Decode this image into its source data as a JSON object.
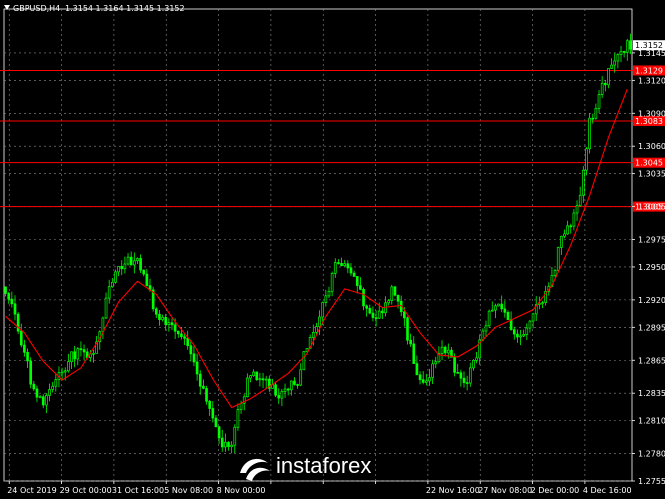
{
  "header": {
    "symbol": "GBPUSD,H4",
    "ohlc": "1.3154 1.3164 1.3145 1.3152"
  },
  "watermark": {
    "text": "instaforex"
  },
  "colors": {
    "background": "#000000",
    "grid": "#8c8c8c",
    "candle": "#00ff00",
    "level": "#ff0000",
    "moving_average": "#ff0000",
    "axis": "#ffffff"
  },
  "chart_data": {
    "type": "candlestick",
    "symbol": "GBPUSD",
    "timeframe": "H4",
    "ylim": [
      1.2755,
      1.3185
    ],
    "y_ticks": [
      1.3145,
      1.312,
      1.309,
      1.306,
      1.3035,
      1.3005,
      1.2975,
      1.295,
      1.292,
      1.2895,
      1.2865,
      1.2835,
      1.281,
      1.278,
      1.2755
    ],
    "x_ticks": [
      "24 Oct 2019",
      "29 Oct 00:00",
      "31 Oct 16:00",
      "5 Nov 08:00",
      "8 Nov 00:00",
      "",
      "",
      "",
      "22 Nov 16:00",
      "27 Nov 08:00",
      "2 Dec 00:00",
      "4 Dec 16:00"
    ],
    "grid": true,
    "levels": [
      {
        "label": "1.3129",
        "value": 1.3129
      },
      {
        "label": "1.3083",
        "value": 1.3083
      },
      {
        "label": "1.3045",
        "value": 1.3045
      },
      {
        "label": "1.3005",
        "value": 1.3005
      }
    ],
    "current_price": {
      "label": "1.3152",
      "value": 1.3152
    },
    "path_close": [
      [
        0,
        1.2927
      ],
      [
        3,
        1.2905
      ],
      [
        6,
        1.2873
      ],
      [
        9,
        1.2835
      ],
      [
        12,
        1.2828
      ],
      [
        15,
        1.2839
      ],
      [
        18,
        1.2855
      ],
      [
        21,
        1.2868
      ],
      [
        24,
        1.2875
      ],
      [
        27,
        1.2868
      ],
      [
        30,
        1.2892
      ],
      [
        33,
        1.293
      ],
      [
        36,
        1.2949
      ],
      [
        39,
        1.2957
      ],
      [
        42,
        1.2953
      ],
      [
        45,
        1.2932
      ],
      [
        48,
        1.2909
      ],
      [
        51,
        1.2899
      ],
      [
        54,
        1.2889
      ],
      [
        57,
        1.2883
      ],
      [
        60,
        1.2862
      ],
      [
        63,
        1.2838
      ],
      [
        66,
        1.2815
      ],
      [
        69,
        1.2787
      ],
      [
        72,
        1.2791
      ],
      [
        75,
        1.2828
      ],
      [
        78,
        1.2853
      ],
      [
        81,
        1.2849
      ],
      [
        84,
        1.284
      ],
      [
        87,
        1.2834
      ],
      [
        90,
        1.284
      ],
      [
        93,
        1.2844
      ],
      [
        96,
        1.288
      ],
      [
        99,
        1.2897
      ],
      [
        102,
        1.2921
      ],
      [
        105,
        1.2952
      ],
      [
        108,
        1.2955
      ],
      [
        111,
        1.2941
      ],
      [
        114,
        1.2918
      ],
      [
        117,
        1.2905
      ],
      [
        120,
        1.2912
      ],
      [
        123,
        1.2928
      ],
      [
        126,
        1.2913
      ],
      [
        129,
        1.2875
      ],
      [
        132,
        1.2847
      ],
      [
        135,
        1.2853
      ],
      [
        138,
        1.2872
      ],
      [
        141,
        1.2876
      ],
      [
        144,
        1.285
      ],
      [
        147,
        1.2847
      ],
      [
        150,
        1.287
      ],
      [
        153,
        1.29
      ],
      [
        156,
        1.2915
      ],
      [
        159,
        1.2907
      ],
      [
        162,
        1.2889
      ],
      [
        165,
        1.2893
      ],
      [
        168,
        1.2909
      ],
      [
        171,
        1.2917
      ],
      [
        174,
        1.2939
      ],
      [
        177,
        1.2975
      ],
      [
        180,
        1.2991
      ],
      [
        183,
        1.3012
      ],
      [
        186,
        1.3082
      ],
      [
        189,
        1.3106
      ],
      [
        192,
        1.3126
      ],
      [
        195,
        1.3143
      ],
      [
        198,
        1.3152
      ]
    ],
    "moving_average_path": [
      [
        0,
        1.2905
      ],
      [
        6,
        1.289
      ],
      [
        12,
        1.2864
      ],
      [
        18,
        1.2847
      ],
      [
        24,
        1.2858
      ],
      [
        30,
        1.2885
      ],
      [
        36,
        1.2918
      ],
      [
        42,
        1.2937
      ],
      [
        48,
        1.2925
      ],
      [
        54,
        1.29
      ],
      [
        60,
        1.2879
      ],
      [
        66,
        1.2848
      ],
      [
        72,
        1.2822
      ],
      [
        78,
        1.283
      ],
      [
        84,
        1.2841
      ],
      [
        90,
        1.2853
      ],
      [
        96,
        1.2871
      ],
      [
        102,
        1.2905
      ],
      [
        108,
        1.293
      ],
      [
        114,
        1.2925
      ],
      [
        120,
        1.2913
      ],
      [
        126,
        1.2915
      ],
      [
        132,
        1.289
      ],
      [
        138,
        1.287
      ],
      [
        144,
        1.2868
      ],
      [
        150,
        1.2878
      ],
      [
        156,
        1.2895
      ],
      [
        162,
        1.2903
      ],
      [
        168,
        1.2911
      ],
      [
        174,
        1.2933
      ],
      [
        180,
        1.297
      ],
      [
        186,
        1.3015
      ],
      [
        192,
        1.3068
      ],
      [
        198,
        1.3112
      ]
    ]
  }
}
